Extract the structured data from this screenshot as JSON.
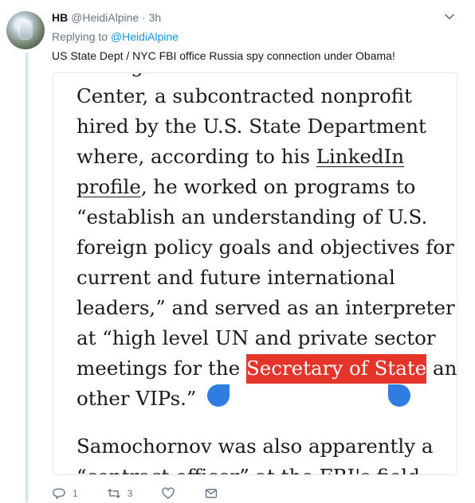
{
  "author": {
    "name": "HB",
    "handle": "@HeidiAlpine",
    "separator": "·",
    "time": "3h"
  },
  "reply": {
    "prefix": "Replying to ",
    "to": "@HeidiAlpine"
  },
  "tweet_text": "US State Dept / NYC FBI office Russia spy connection under Obama!",
  "article": {
    "line0": "manager at the Meridian International",
    "line1": "Center, a subcontracted nonprofit",
    "line2": "hired by the U.S. State Department",
    "line3_pre": "where, according to his ",
    "line3_link": "LinkedIn",
    "line4_link": "profile",
    "line4_post": ", he worked on programs to",
    "line5": "“establish an understanding of U.S.",
    "line6": "foreign policy goals and objectives for",
    "line7": "current and future international",
    "line8": "leaders,” and served as an interpreter",
    "line9": "at “high level UN and private sector",
    "line10_pre": "meetings for the ",
    "line10_selected": "Secretary of State",
    "line10_post": " and",
    "line11": "other VIPs.”",
    "line12": "Samochornov was also apparently a",
    "line13": "“contract officer” at the FBI's field"
  },
  "actions": {
    "reply_count": "1",
    "retweet_count": "3"
  },
  "colors": {
    "selection": "#e5352b",
    "handles": "#2f7de1",
    "link": "#1b95e0",
    "thread": "#cfe5f5"
  },
  "icons": [
    "avatar",
    "chevron-down-icon",
    "reply-icon",
    "retweet-icon",
    "like-icon",
    "message-icon"
  ]
}
